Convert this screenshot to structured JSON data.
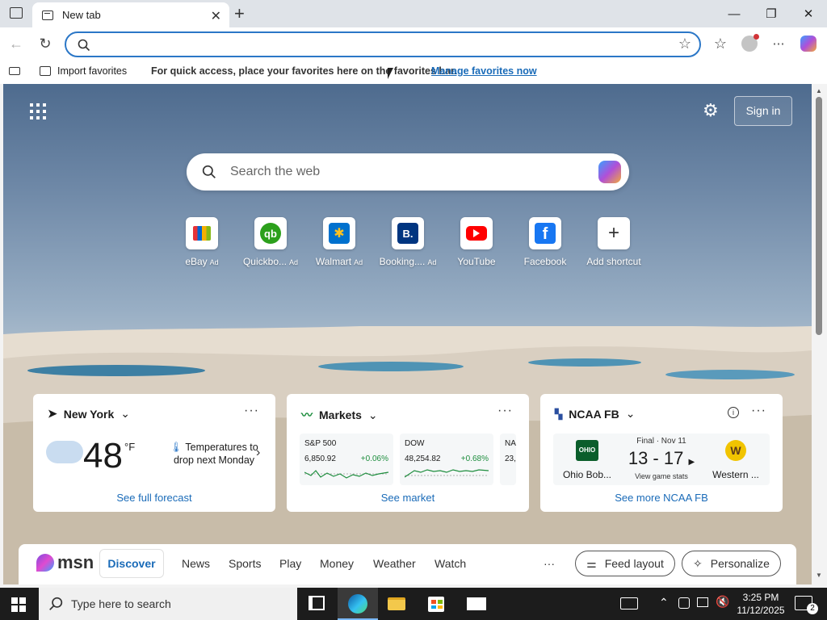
{
  "tab": {
    "title": "New tab"
  },
  "omnibox": {
    "value": "",
    "placeholder": ""
  },
  "favbar": {
    "import_label": "Import favorites",
    "message": "For quick access, place your favorites here on the favorites bar.",
    "manage_link": "Manage favorites now"
  },
  "header": {
    "sign_in": "Sign in"
  },
  "search": {
    "placeholder": "Search the web"
  },
  "shortcuts": [
    {
      "label": "eBay",
      "ad": "Ad"
    },
    {
      "label": "Quickbo...",
      "ad": "Ad"
    },
    {
      "label": "Walmart",
      "ad": "Ad"
    },
    {
      "label": "Booking....",
      "ad": "Ad"
    },
    {
      "label": "YouTube",
      "ad": ""
    },
    {
      "label": "Facebook",
      "ad": ""
    },
    {
      "label": "Add shortcut",
      "ad": ""
    }
  ],
  "weather": {
    "location": "New York",
    "temp": "48",
    "unit": "°F",
    "alert": "Temperatures to drop next Monday",
    "link": "See full forecast"
  },
  "markets": {
    "title": "Markets",
    "items": [
      {
        "name": "S&P 500",
        "value": "6,850.92",
        "change": "+0.06%"
      },
      {
        "name": "DOW",
        "value": "48,254.82",
        "change": "+0.68%"
      },
      {
        "name": "NA",
        "value": "23,",
        "change": ""
      }
    ],
    "link": "See market"
  },
  "ncaa": {
    "title": "NCAA FB",
    "status": "Final · Nov 11",
    "team1": "Ohio Bob...",
    "team1_logo": "OHIO",
    "team2": "Western ...",
    "team2_logo": "W",
    "score": "13 - 17",
    "stats": "View game stats",
    "link": "See more NCAA FB"
  },
  "msn": {
    "brand": "msn",
    "nav": [
      "Discover",
      "News",
      "Sports",
      "Play",
      "Money",
      "Weather",
      "Watch"
    ],
    "feed_layout": "Feed layout",
    "personalize": "Personalize"
  },
  "taskbar": {
    "search_placeholder": "Type here to search",
    "time": "3:25 PM",
    "date": "11/12/2025",
    "notifications": "2"
  },
  "colors": {
    "accent": "#2b77c7",
    "link": "#1a6bb8",
    "market_up": "#1e8e3e",
    "taskbar": "#1c1c1c"
  }
}
